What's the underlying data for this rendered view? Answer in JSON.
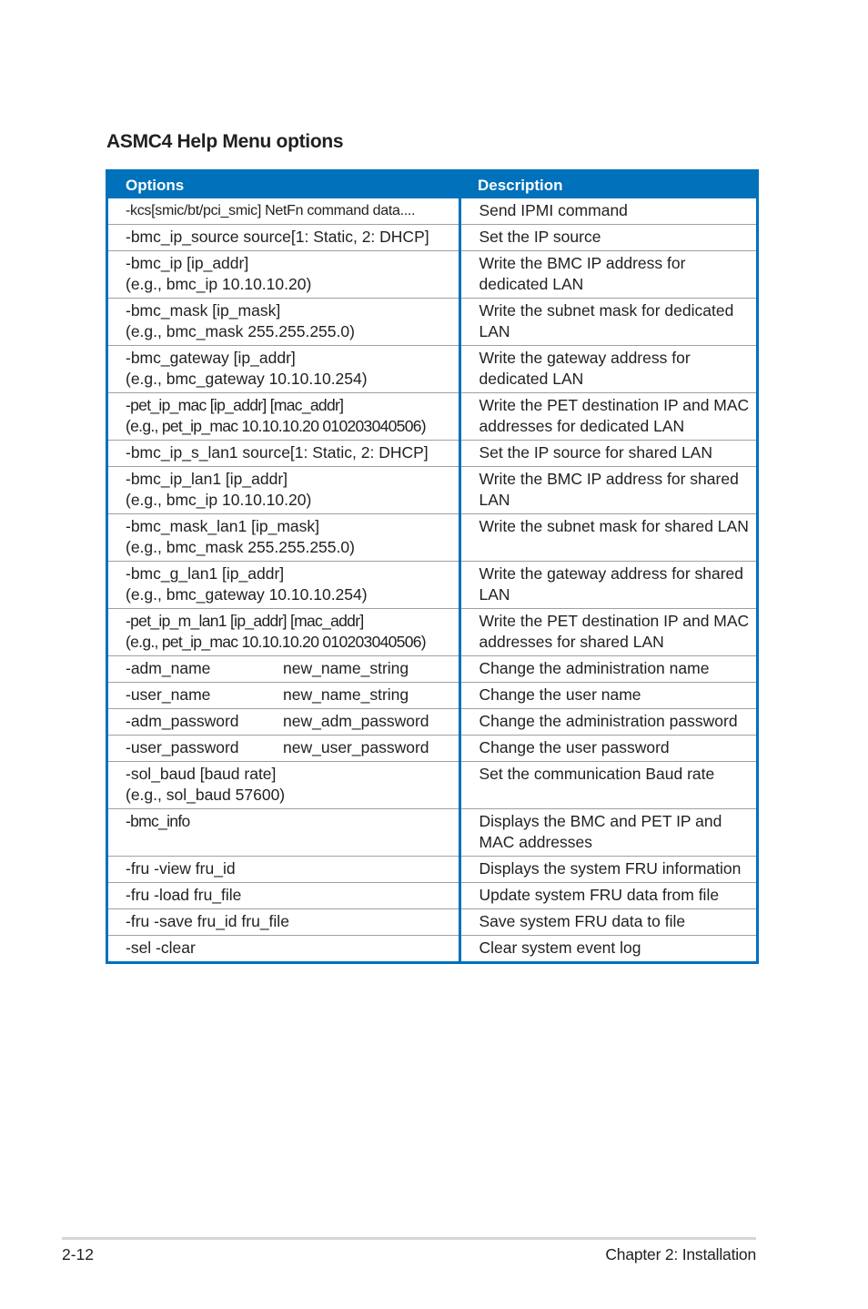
{
  "title": "ASMC4 Help Menu options",
  "table": {
    "headers": {
      "options": "Options",
      "description": "Description"
    },
    "rows": [
      {
        "option": [
          "-kcs[smic/bt/pci_smic] NetFn command data...."
        ],
        "description": "Send IPMI command",
        "style": "small"
      },
      {
        "option": [
          "-bmc_ip_source source[1: Static, 2: DHCP]"
        ],
        "description": "Set the IP source"
      },
      {
        "option": [
          "-bmc_ip [ip_addr]",
          "(e.g., bmc_ip 10.10.10.20)"
        ],
        "description": "Write the BMC IP address for dedicated LAN"
      },
      {
        "option": [
          "-bmc_mask [ip_mask]",
          "(e.g., bmc_mask 255.255.255.0)"
        ],
        "description": "Write the subnet mask for dedicated LAN"
      },
      {
        "option": [
          "-bmc_gateway [ip_addr]",
          "(e.g., bmc_gateway 10.10.10.254)"
        ],
        "description": "Write the gateway address for dedicated LAN"
      },
      {
        "option": [
          "-pet_ip_mac [ip_addr] [mac_addr]",
          "(e.g., pet_ip_mac 10.10.10.20 010203040506)"
        ],
        "description": "Write the PET destination IP and MAC addresses for dedicated LAN",
        "style": "cond"
      },
      {
        "option": [
          "-bmc_ip_s_lan1 source[1: Static, 2: DHCP]"
        ],
        "description": "Set the IP source for shared LAN"
      },
      {
        "option": [
          "-bmc_ip_lan1 [ip_addr]",
          "(e.g., bmc_ip 10.10.10.20)"
        ],
        "description": "Write the BMC IP address for shared LAN"
      },
      {
        "option": [
          "-bmc_mask_lan1 [ip_mask]",
          "(e.g., bmc_mask 255.255.255.0)"
        ],
        "description": "Write the subnet mask for shared LAN"
      },
      {
        "option": [
          "-bmc_g_lan1 [ip_addr]",
          "(e.g., bmc_gateway 10.10.10.254)"
        ],
        "description": "Write the gateway address for shared LAN"
      },
      {
        "option": [
          "-pet_ip_m_lan1 [ip_addr] [mac_addr]",
          "(e.g., pet_ip_mac 10.10.10.20 010203040506)"
        ],
        "description": "Write the PET destination IP and MAC addresses for shared LAN",
        "style": "cond"
      },
      {
        "option": [
          "-adm_name",
          "new_name_string"
        ],
        "description": "Change the administration name",
        "layout": "split"
      },
      {
        "option": [
          "-user_name",
          "new_name_string"
        ],
        "description": "Change the user name",
        "layout": "split"
      },
      {
        "option": [
          "-adm_password",
          "new_adm_password"
        ],
        "description": "Change the administration password",
        "layout": "split"
      },
      {
        "option": [
          "-user_password",
          "new_user_password"
        ],
        "description": "Change the user password",
        "layout": "split"
      },
      {
        "option": [
          "-sol_baud [baud rate]",
          "(e.g., sol_baud 57600)"
        ],
        "description": "Set the communication Baud rate"
      },
      {
        "option": [
          "-bmc_info",
          ""
        ],
        "description": "Displays the BMC and PET IP and MAC addresses",
        "style": "cond"
      },
      {
        "option": [
          "-fru -view fru_id"
        ],
        "description": "Displays the system FRU information"
      },
      {
        "option": [
          "-fru -load fru_file"
        ],
        "description": "Update system FRU data from file"
      },
      {
        "option": [
          "-fru -save fru_id fru_file"
        ],
        "description": "Save system FRU data to file"
      },
      {
        "option": [
          "-sel -clear"
        ],
        "description": "Clear system event log"
      }
    ]
  },
  "footer": {
    "page_number": "2-12",
    "chapter": "Chapter 2: Installation"
  },
  "colors": {
    "accent": "#0071bb",
    "rule": "#d6d6d6"
  }
}
